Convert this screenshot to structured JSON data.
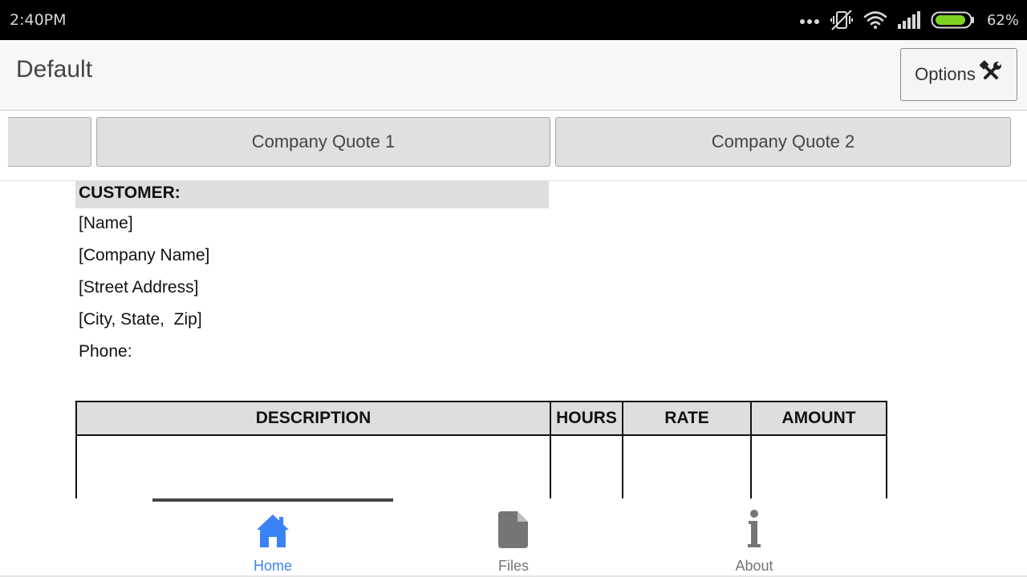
{
  "status_bar": {
    "time": "2:40PM",
    "battery_percent": "62%",
    "icons": [
      "more-dots-icon",
      "vibrate-off-icon",
      "wifi-icon",
      "signal-icon",
      "battery-icon"
    ],
    "battery_color": "#7ed321"
  },
  "header": {
    "title": "Default",
    "options_label": "Options",
    "options_icon": "tools-icon"
  },
  "tabs": [
    {
      "label": ""
    },
    {
      "label": "Company Quote 1"
    },
    {
      "label": "Company Quote 2"
    }
  ],
  "document": {
    "customer_header": "CUSTOMER:",
    "customer_lines": [
      "[Name]",
      "[Company Name]",
      "[Street Address]",
      "[City, State,  Zip]",
      "Phone:"
    ],
    "table": {
      "headers": [
        "DESCRIPTION",
        "HOURS",
        "RATE",
        "AMOUNT"
      ]
    }
  },
  "bottom_nav": {
    "active_color": "#3b82f6",
    "inactive_color": "#757575",
    "items": [
      {
        "label": "Home",
        "icon": "home-icon",
        "active": true
      },
      {
        "label": "Files",
        "icon": "file-icon",
        "active": false
      },
      {
        "label": "About",
        "icon": "info-icon",
        "active": false
      }
    ]
  }
}
